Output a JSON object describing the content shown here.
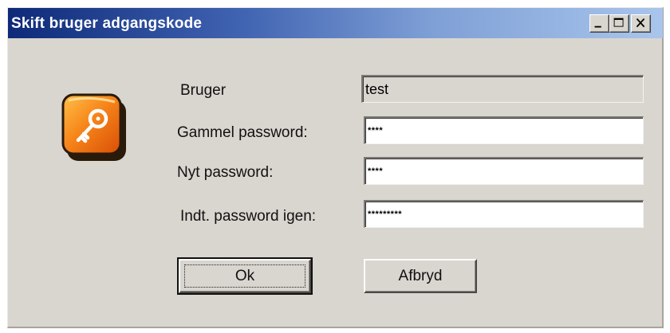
{
  "window": {
    "title": "Skift bruger adgangskode",
    "controls": [
      "minimize",
      "maximize",
      "close"
    ]
  },
  "icon": "key-icon",
  "form": {
    "user_label": "Bruger",
    "user_value": "test",
    "old_password_label": "Gammel password:",
    "old_password_value": "****",
    "new_password_label": "Nyt password:",
    "new_password_value": "****",
    "repeat_password_label": "Indt. password igen:",
    "repeat_password_value": "*********"
  },
  "buttons": {
    "ok_label": "Ok",
    "cancel_label": "Afbryd"
  },
  "colors": {
    "titlebar_start": "#0e2a78",
    "titlebar_end": "#a9c5ec",
    "window_bg": "#d9d5cf",
    "icon_orange": "#f07a12"
  }
}
